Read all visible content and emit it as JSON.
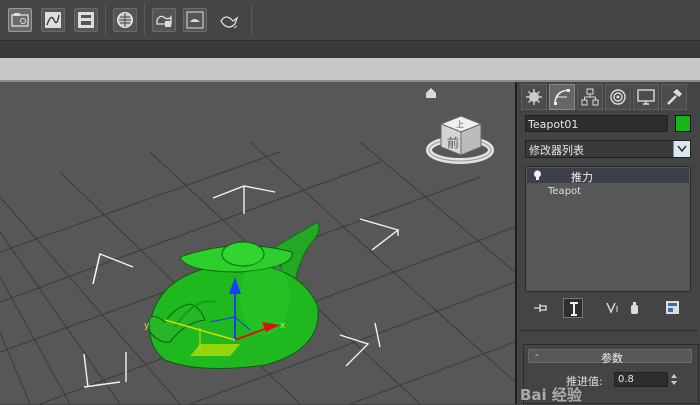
{
  "toolbar": {
    "buttons": [
      {
        "name": "scene-explorer-icon",
        "active": true
      },
      {
        "name": "curve-editor-icon",
        "active": false
      },
      {
        "name": "schematic-view-icon",
        "active": false
      },
      {
        "name": "material-editor-icon",
        "active": false
      },
      {
        "name": "render-setup-icon",
        "active": false
      },
      {
        "name": "rendered-frame-icon",
        "active": false
      },
      {
        "name": "render-teapot-icon",
        "active": false
      }
    ]
  },
  "command_panel": {
    "tabs": [
      "create-tab",
      "modify-tab",
      "hierarchy-tab",
      "motion-tab",
      "display-tab",
      "utilities-tab"
    ],
    "object_name": "Teapot01",
    "object_color": "#19b419",
    "modifier_list_label": "修改器列表",
    "stack": {
      "modifier": "推力",
      "base_object": "Teapot"
    },
    "rollout": {
      "title": "参数",
      "toggle": "-",
      "param_label": "推进值:",
      "param_value": "0.8"
    }
  },
  "viewport": {
    "viewcube_face": "前",
    "viewcube_top": "上",
    "object_color": "#1fb81f"
  },
  "watermark": "Bai 经验"
}
